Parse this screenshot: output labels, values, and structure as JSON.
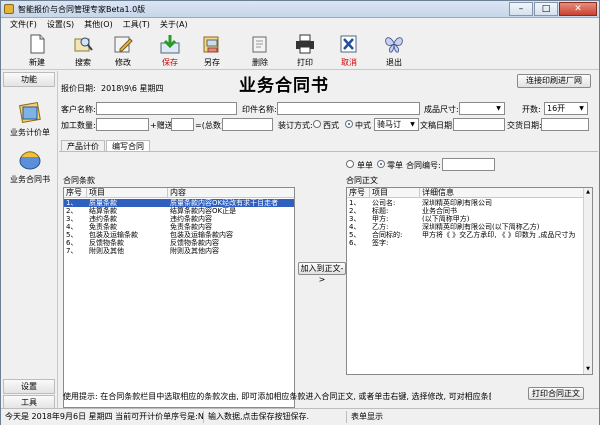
{
  "window": {
    "title": "智能报价与合同管理专家Beta1.0版"
  },
  "menu": [
    "文件(F)",
    "设置(S)",
    "其他(O)",
    "工具(T)",
    "关于(A)"
  ],
  "toolbar": {
    "new": "新建",
    "search": "搜索",
    "modify": "修改",
    "save": "保存",
    "save_as": "另存",
    "delete": "删除",
    "print": "打印",
    "cancel": "取消",
    "exit": "退出"
  },
  "sidebar": {
    "function_header": "功能",
    "quote_sheet": "业务计价单",
    "contract": "业务合同书",
    "settings": "设置",
    "tools": "工具"
  },
  "form": {
    "title": "业务合同书",
    "report_date_label": "报价日期:",
    "report_date": "2018\\9\\6 星期四",
    "connect_button": "连接印刷进厂网",
    "customer_label": "客户名称:",
    "print_name_label": "印件名称:",
    "size_label": "成品尺寸:",
    "kaishu_label": "开数:",
    "kaishu_value": "16开",
    "qty_label": "加工数量:",
    "gift_label": "+赠送",
    "total_label": "=(总数)",
    "binding_label": "装订方式:",
    "west_label": "西式",
    "chinese_label": "中式",
    "binding_value": "骑马订",
    "proof_date_label": "文稿日期:",
    "delivery_date_label": "交货日期:"
  },
  "tabs": [
    "产品计价",
    "编写合同"
  ],
  "clauses": {
    "section_label": "合同条款",
    "headers": [
      "序号",
      "项目",
      "内容"
    ],
    "rows": [
      [
        "1、",
        "质量条款",
        "质量条款内容OK经改有求干目走者"
      ],
      [
        "2、",
        "结算条款",
        "结算条款内容OK正是"
      ],
      [
        "3、",
        "违约条款",
        "违约条款内容"
      ],
      [
        "4、",
        "免责条款",
        "免责条款内容"
      ],
      [
        "5、",
        "包装及运输条款",
        "包装及运输条款内容"
      ],
      [
        "6、",
        "反馈物条款",
        "反馈物条款内容"
      ],
      [
        "7、",
        "附则及其他",
        "附则及其他内容"
      ]
    ]
  },
  "add_button": "加入到正文->",
  "contract_body": {
    "single_label": "单单",
    "zero_label": "零单",
    "number_label": "合同编号:",
    "section_label": "合同正文",
    "headers": [
      "序号",
      "项目",
      "详细信息"
    ],
    "rows": [
      [
        "1、",
        "公司名:",
        "深圳精英印刷有限公司"
      ],
      [
        "2、",
        "标题:",
        "业务合同书"
      ],
      [
        "3、",
        "甲方:",
        "(以下简称甲方)"
      ],
      [
        "4、",
        "乙方:",
        "深圳精英印刷有限公司(以下简称乙方)"
      ],
      [
        "5、",
        "合同标的:",
        "甲方将《 》交乙方承印, 《 》印数为 ,成品尺寸为"
      ],
      [
        "6、",
        "签字:",
        ""
      ]
    ]
  },
  "hint": "使用提示: 在合同条款栏目中选取相应的条款次由, 即可添加相应条款进入合同正文, 或者单击右键, 选择修改, 可对相应条款进行文字修改",
  "print_contract_button": "打印合同正文",
  "status": {
    "left": "今天是 2018年9月6日 星期四 当前可开计价单序号是:N0:1",
    "middle": "输入数据,点击保存按钮保存.",
    "right": "表单显示"
  }
}
